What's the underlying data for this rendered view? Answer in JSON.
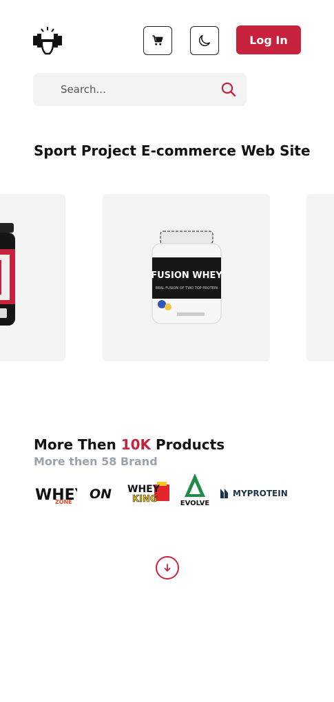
{
  "header": {
    "logo_icon": "gym-logo-icon",
    "cart_icon": "cart-icon",
    "theme_icon": "moon-icon",
    "login_label": "Log In"
  },
  "search": {
    "placeholder": "Search...",
    "icon": "search-icon"
  },
  "hero": {
    "title": "Sport Project E-commerce Web Site"
  },
  "carousel": {
    "center_product_label": "FUSION WHEY",
    "center_product_tag": "REAL FUSION OF TWO TOP PROTEIN"
  },
  "stats": {
    "heading_prefix": "More Then ",
    "heading_accent": "10K",
    "heading_suffix": " Products",
    "subheading": "More then 58 Brand"
  },
  "brands": [
    {
      "name": "WHEY ZONE",
      "text": "WHEY",
      "subtext": "ZONE"
    },
    {
      "name": "ON",
      "text": "ON"
    },
    {
      "name": "WHEY KING",
      "text": "WHEY",
      "subtext": "KING"
    },
    {
      "name": "EVOLVE",
      "text": "EVOLVE"
    },
    {
      "name": "MYPROTEIN",
      "text": "MYPROTEIN"
    }
  ],
  "colors": {
    "accent": "#c8233e",
    "muted": "#9aa3ad",
    "card_bg": "#f4f4f4"
  },
  "scroll": {
    "icon": "arrow-down-circle-icon"
  }
}
